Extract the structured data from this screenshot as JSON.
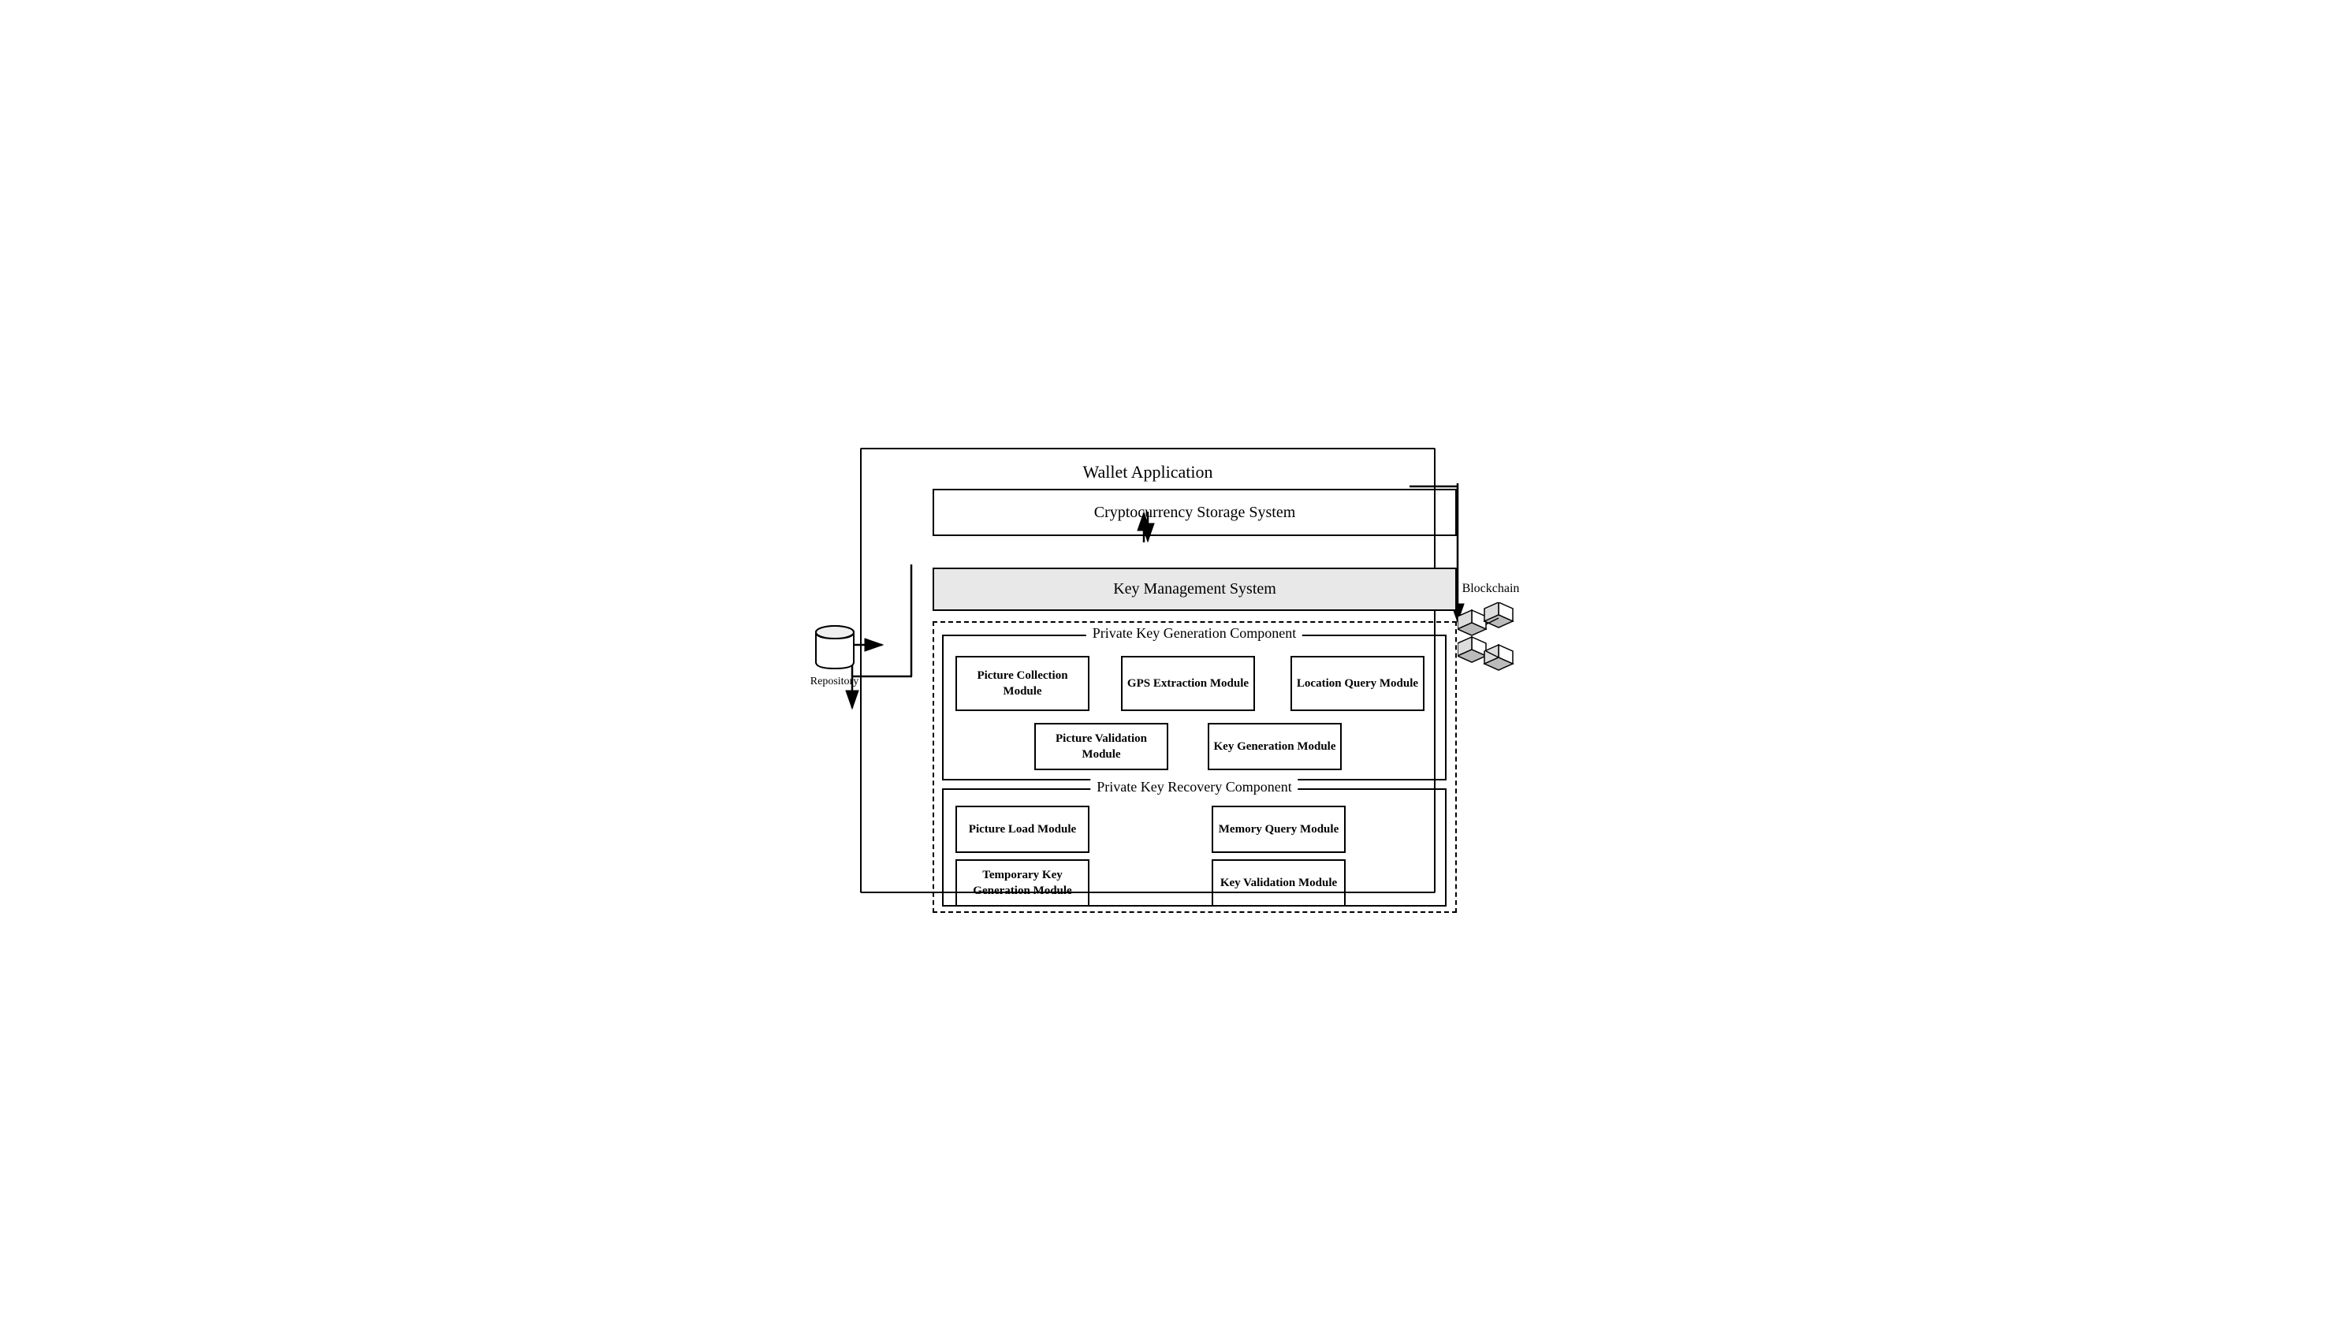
{
  "diagram": {
    "title": "Wallet Application",
    "crypto_storage": "Cryptocurrency Storage System",
    "key_mgmt": "Key Management System",
    "pkgen_component": "Private Key Generation Component",
    "pkrecov_component": "Private Key Recovery Component",
    "modules": {
      "picture_collection": "Picture Collection Module",
      "gps_extraction": "GPS Extraction Module",
      "location_query": "Location Query Module",
      "picture_validation": "Picture Validation Module",
      "key_generation": "Key Generation Module",
      "picture_load": "Picture Load Module",
      "memory_query": "Memory Query Module",
      "temp_key_gen": "Temporary Key Generation Module",
      "key_validation": "Key Validation Module"
    },
    "repository": "Repository",
    "blockchain": "Blockchain"
  }
}
